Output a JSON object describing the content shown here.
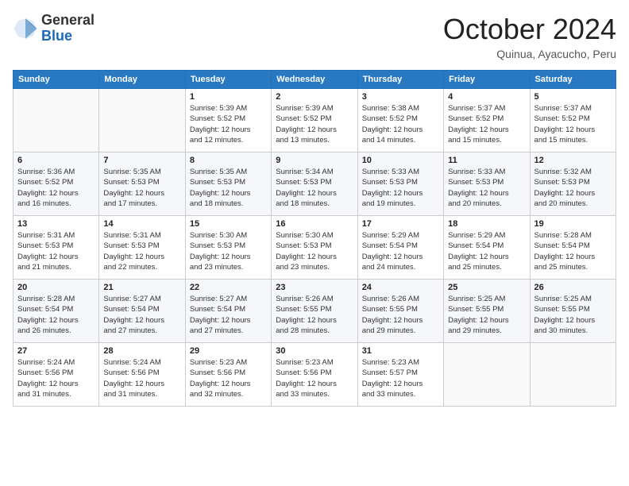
{
  "header": {
    "logo_general": "General",
    "logo_blue": "Blue",
    "month_title": "October 2024",
    "location": "Quinua, Ayacucho, Peru"
  },
  "calendar": {
    "headers": [
      "Sunday",
      "Monday",
      "Tuesday",
      "Wednesday",
      "Thursday",
      "Friday",
      "Saturday"
    ],
    "weeks": [
      [
        {
          "day": "",
          "info": ""
        },
        {
          "day": "",
          "info": ""
        },
        {
          "day": "1",
          "info": "Sunrise: 5:39 AM\nSunset: 5:52 PM\nDaylight: 12 hours\nand 12 minutes."
        },
        {
          "day": "2",
          "info": "Sunrise: 5:39 AM\nSunset: 5:52 PM\nDaylight: 12 hours\nand 13 minutes."
        },
        {
          "day": "3",
          "info": "Sunrise: 5:38 AM\nSunset: 5:52 PM\nDaylight: 12 hours\nand 14 minutes."
        },
        {
          "day": "4",
          "info": "Sunrise: 5:37 AM\nSunset: 5:52 PM\nDaylight: 12 hours\nand 15 minutes."
        },
        {
          "day": "5",
          "info": "Sunrise: 5:37 AM\nSunset: 5:52 PM\nDaylight: 12 hours\nand 15 minutes."
        }
      ],
      [
        {
          "day": "6",
          "info": "Sunrise: 5:36 AM\nSunset: 5:52 PM\nDaylight: 12 hours\nand 16 minutes."
        },
        {
          "day": "7",
          "info": "Sunrise: 5:35 AM\nSunset: 5:53 PM\nDaylight: 12 hours\nand 17 minutes."
        },
        {
          "day": "8",
          "info": "Sunrise: 5:35 AM\nSunset: 5:53 PM\nDaylight: 12 hours\nand 18 minutes."
        },
        {
          "day": "9",
          "info": "Sunrise: 5:34 AM\nSunset: 5:53 PM\nDaylight: 12 hours\nand 18 minutes."
        },
        {
          "day": "10",
          "info": "Sunrise: 5:33 AM\nSunset: 5:53 PM\nDaylight: 12 hours\nand 19 minutes."
        },
        {
          "day": "11",
          "info": "Sunrise: 5:33 AM\nSunset: 5:53 PM\nDaylight: 12 hours\nand 20 minutes."
        },
        {
          "day": "12",
          "info": "Sunrise: 5:32 AM\nSunset: 5:53 PM\nDaylight: 12 hours\nand 20 minutes."
        }
      ],
      [
        {
          "day": "13",
          "info": "Sunrise: 5:31 AM\nSunset: 5:53 PM\nDaylight: 12 hours\nand 21 minutes."
        },
        {
          "day": "14",
          "info": "Sunrise: 5:31 AM\nSunset: 5:53 PM\nDaylight: 12 hours\nand 22 minutes."
        },
        {
          "day": "15",
          "info": "Sunrise: 5:30 AM\nSunset: 5:53 PM\nDaylight: 12 hours\nand 23 minutes."
        },
        {
          "day": "16",
          "info": "Sunrise: 5:30 AM\nSunset: 5:53 PM\nDaylight: 12 hours\nand 23 minutes."
        },
        {
          "day": "17",
          "info": "Sunrise: 5:29 AM\nSunset: 5:54 PM\nDaylight: 12 hours\nand 24 minutes."
        },
        {
          "day": "18",
          "info": "Sunrise: 5:29 AM\nSunset: 5:54 PM\nDaylight: 12 hours\nand 25 minutes."
        },
        {
          "day": "19",
          "info": "Sunrise: 5:28 AM\nSunset: 5:54 PM\nDaylight: 12 hours\nand 25 minutes."
        }
      ],
      [
        {
          "day": "20",
          "info": "Sunrise: 5:28 AM\nSunset: 5:54 PM\nDaylight: 12 hours\nand 26 minutes."
        },
        {
          "day": "21",
          "info": "Sunrise: 5:27 AM\nSunset: 5:54 PM\nDaylight: 12 hours\nand 27 minutes."
        },
        {
          "day": "22",
          "info": "Sunrise: 5:27 AM\nSunset: 5:54 PM\nDaylight: 12 hours\nand 27 minutes."
        },
        {
          "day": "23",
          "info": "Sunrise: 5:26 AM\nSunset: 5:55 PM\nDaylight: 12 hours\nand 28 minutes."
        },
        {
          "day": "24",
          "info": "Sunrise: 5:26 AM\nSunset: 5:55 PM\nDaylight: 12 hours\nand 29 minutes."
        },
        {
          "day": "25",
          "info": "Sunrise: 5:25 AM\nSunset: 5:55 PM\nDaylight: 12 hours\nand 29 minutes."
        },
        {
          "day": "26",
          "info": "Sunrise: 5:25 AM\nSunset: 5:55 PM\nDaylight: 12 hours\nand 30 minutes."
        }
      ],
      [
        {
          "day": "27",
          "info": "Sunrise: 5:24 AM\nSunset: 5:56 PM\nDaylight: 12 hours\nand 31 minutes."
        },
        {
          "day": "28",
          "info": "Sunrise: 5:24 AM\nSunset: 5:56 PM\nDaylight: 12 hours\nand 31 minutes."
        },
        {
          "day": "29",
          "info": "Sunrise: 5:23 AM\nSunset: 5:56 PM\nDaylight: 12 hours\nand 32 minutes."
        },
        {
          "day": "30",
          "info": "Sunrise: 5:23 AM\nSunset: 5:56 PM\nDaylight: 12 hours\nand 33 minutes."
        },
        {
          "day": "31",
          "info": "Sunrise: 5:23 AM\nSunset: 5:57 PM\nDaylight: 12 hours\nand 33 minutes."
        },
        {
          "day": "",
          "info": ""
        },
        {
          "day": "",
          "info": ""
        }
      ]
    ]
  }
}
